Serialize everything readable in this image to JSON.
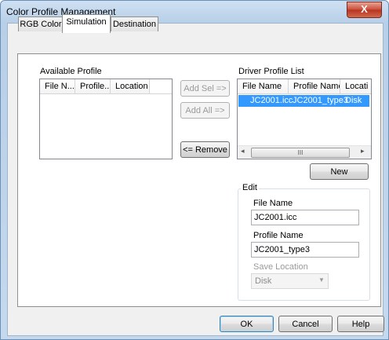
{
  "window": {
    "title": "Color Profile Management",
    "close_glyph": "X"
  },
  "tabs": [
    {
      "label": "RGB Color",
      "active": false
    },
    {
      "label": "Simulation",
      "active": true
    },
    {
      "label": "Destination",
      "active": false
    }
  ],
  "available_profile": {
    "label": "Available Profile",
    "columns": [
      "File N...",
      "Profile...",
      "Location"
    ],
    "rows": []
  },
  "transfer_buttons": {
    "add_sel": "Add Sel =>",
    "add_all": "Add All =>",
    "remove": "<= Remove"
  },
  "driver_profile_list": {
    "label": "Driver Profile List",
    "columns": [
      "File Name",
      "Profile Name",
      "Locati"
    ],
    "rows": [
      {
        "file_name": "JC2001.icc",
        "profile_name": "JC2001_type3",
        "location": "Disk",
        "selected": true
      }
    ],
    "scroll_thumb_glyph": "III",
    "scroll_left_glyph": "◂",
    "scroll_right_glyph": "▸"
  },
  "new_button": "New",
  "edit": {
    "title": "Edit",
    "file_name_label": "File Name",
    "file_name_value": "JC2001.icc",
    "profile_name_label": "Profile Name",
    "profile_name_value": "JC2001_type3",
    "save_location_label": "Save Location",
    "save_location_value": "Disk",
    "save_location_enabled": false
  },
  "footer": {
    "ok": "OK",
    "cancel": "Cancel",
    "help": "Help"
  },
  "colors": {
    "selection": "#3399ff",
    "close_button": "#c94c39",
    "title_bar": "#cfe0f2"
  }
}
